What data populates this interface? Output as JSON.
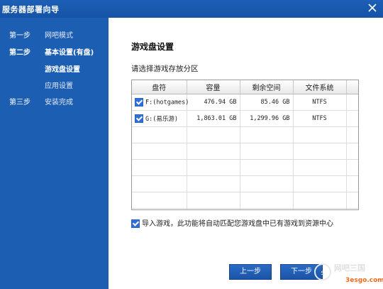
{
  "window": {
    "title": "服务器部署向导"
  },
  "sidebar": {
    "steps": [
      {
        "step": "第一步",
        "label": "网吧模式"
      },
      {
        "step": "第二步",
        "label": "基本设置(有盘)"
      },
      {
        "step": "",
        "label": "游戏盘设置"
      },
      {
        "step": "",
        "label": "应用设置"
      },
      {
        "step": "第三步",
        "label": "安装完成"
      }
    ]
  },
  "main": {
    "heading": "游戏盘设置",
    "subtitle": "请选择游戏存放分区",
    "table": {
      "columns": [
        "盘符",
        "容量",
        "剩余空间",
        "文件系统"
      ],
      "rows": [
        {
          "checked": true,
          "drive": "F:(hotgames)",
          "capacity": "476.94 GB",
          "free": "85.46 GB",
          "fs": "NTFS"
        },
        {
          "checked": true,
          "drive": "G:(易乐游)",
          "capacity": "1,863.01 GB",
          "free": "1,299.96 GB",
          "fs": "NTFS"
        }
      ]
    },
    "import_checkbox": {
      "checked": true,
      "label": "导入游戏，此功能将自动匹配您游戏盘中已有游戏到资源中心"
    }
  },
  "buttons": {
    "prev": "上一步",
    "next": "下一步"
  },
  "watermark": {
    "text": "网吧三国",
    "url": "3esgo.com"
  },
  "colors": {
    "sidebar": "#1c5fb2",
    "titlebar": "#1d5fb6",
    "button": "#1a54a6"
  }
}
